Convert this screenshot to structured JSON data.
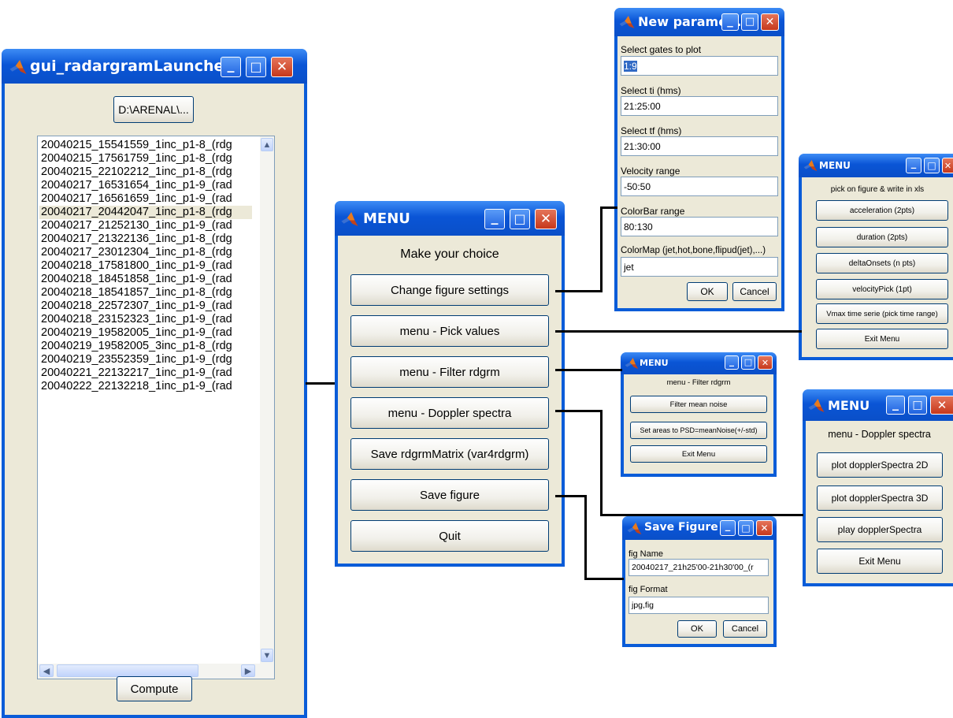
{
  "launcher": {
    "title": "gui_radargramLauncher",
    "path_button": "D:\\ARENAL\\...",
    "files": [
      "20040215_15541559_1inc_p1-8_(rdg",
      "20040215_17561759_1inc_p1-8_(rdg",
      "20040215_22102212_1inc_p1-8_(rdg",
      "20040217_16531654_1inc_p1-9_(rad",
      "20040217_16561659_1inc_p1-9_(rad",
      "20040217_20442047_1inc_p1-8_(rdg",
      "20040217_21252130_1inc_p1-9_(rad",
      "20040217_21322136_1inc_p1-8_(rdg",
      "20040217_23012304_1inc_p1-8_(rdg",
      "20040218_17581800_1inc_p1-9_(rad",
      "20040218_18451858_1inc_p1-9_(rad",
      "20040218_18541857_1inc_p1-8_(rdg",
      "20040218_22572307_1inc_p1-9_(rad",
      "20040218_23152323_1inc_p1-9_(rad",
      "20040219_19582005_1inc_p1-9_(rad",
      "20040219_19582005_3inc_p1-8_(rdg",
      "20040219_23552359_1inc_p1-9_(rdg",
      "20040221_22132217_1inc_p1-9_(rad",
      "20040222_22132218_1inc_p1-9_(rad"
    ],
    "selected_file": "20040217_20442047_1inc_p1-8_(rdg",
    "compute_button": "Compute"
  },
  "main_menu": {
    "title": "MENU",
    "heading": "Make your choice",
    "buttons": {
      "change": "Change figure settings",
      "pick": "menu - Pick values",
      "filter": "menu - Filter rdgrm",
      "doppler": "menu - Doppler spectra",
      "save_matrix": "Save rdgrmMatrix (var4rdgrm)",
      "save_figure": "Save figure",
      "quit": "Quit"
    }
  },
  "new_params": {
    "title": "New parame...",
    "gates_label": "Select gates to plot",
    "gates_value": "1:9",
    "ti_label": "Select ti (hms)",
    "ti_value": "21:25:00",
    "tf_label": "Select tf (hms)",
    "tf_value": "21:30:00",
    "velocity_label": "Velocity range",
    "velocity_value": "-50:50",
    "colorbar_label": "ColorBar range",
    "colorbar_value": "80:130",
    "colormap_label": "ColorMap (jet,hot,bone,flipud(jet),...)",
    "colormap_value": "jet",
    "ok": "OK",
    "cancel": "Cancel"
  },
  "pick_menu": {
    "title": "MENU",
    "heading": "pick on figure & write in xls",
    "buttons": {
      "acceleration": "acceleration (2pts)",
      "duration": "duration (2pts)",
      "delta": "deltaOnsets (n pts)",
      "velocity": "velocityPick (1pt)",
      "vmax": "Vmax time serie (pick time range)",
      "exit": "Exit Menu"
    }
  },
  "filter_menu": {
    "title": "MENU",
    "heading": "menu - Filter rdgrm",
    "buttons": {
      "noise": "Filter mean noise",
      "areas": "Set areas to PSD=meanNoise(+/-std)",
      "exit": "Exit Menu"
    }
  },
  "doppler_menu": {
    "title": "MENU",
    "heading": "menu - Doppler spectra",
    "buttons": {
      "plot2d": "plot dopplerSpectra 2D",
      "plot3d": "plot dopplerSpectra 3D",
      "play": "play dopplerSpectra",
      "exit": "Exit Menu"
    }
  },
  "save_figure": {
    "title": "Save Figure",
    "name_label": "fig Name",
    "name_value": "20040217_21h25'00-21h30'00_(r",
    "format_label": "fig Format",
    "format_value": "jpg,fig",
    "ok": "OK",
    "cancel": "Cancel"
  },
  "title_buttons": {
    "minimize": "_",
    "maximize": "□",
    "close": "✕"
  },
  "scroll_glyphs": {
    "up": "▲",
    "down": "▼",
    "left": "◀",
    "right": "▶"
  },
  "icons": [
    "matlab-logo-icon",
    "minimize-icon",
    "maximize-icon",
    "close-icon",
    "scroll-up-icon",
    "scroll-down-icon",
    "scroll-left-icon",
    "scroll-right-icon"
  ],
  "colors": {
    "xp_blue": "#0a5cd8",
    "window_bg": "#ece9d8",
    "close_red": "#d04a2b",
    "selection": "#ece9d8"
  }
}
